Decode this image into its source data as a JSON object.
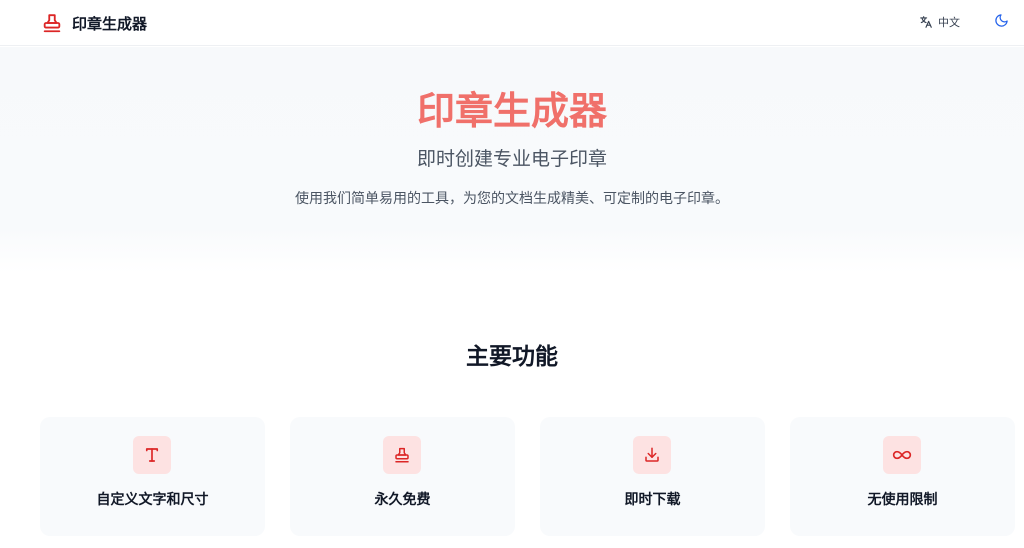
{
  "app": {
    "brand_name": "印章生成器",
    "brand_icon": "stamp-icon",
    "language_label": "中文",
    "language_icon": "translate-icon",
    "theme_icon": "moon-icon"
  },
  "hero": {
    "title": "印章生成器",
    "subtitle": "即时创建专业电子印章",
    "description": "使用我们简单易用的工具，为您的文档生成精美、可定制的电子印章。"
  },
  "features": {
    "title": "主要功能",
    "items": [
      {
        "label": "自定义文字和尺寸",
        "icon": "text-icon"
      },
      {
        "label": "永久免费",
        "icon": "stamp-icon"
      },
      {
        "label": "即时下载",
        "icon": "download-icon"
      },
      {
        "label": "无使用限制",
        "icon": "infinity-icon"
      }
    ]
  },
  "colors": {
    "accent": "#f0706a",
    "icon_red": "#dc2626",
    "icon_bg": "#fde2e2",
    "theme_icon": "#2563eb"
  }
}
